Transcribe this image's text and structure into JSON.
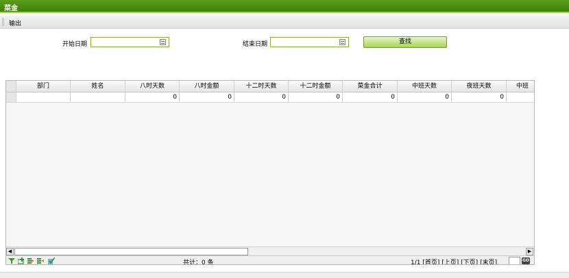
{
  "window": {
    "title": "菜金"
  },
  "toolbar": {
    "export_label": "输出"
  },
  "filters": {
    "start_label": "开始日期",
    "start_value": "",
    "end_label": "结束日期",
    "end_value": "",
    "search_label": "查找"
  },
  "grid": {
    "columns": [
      "部门",
      "姓名",
      "八时天数",
      "八时金额",
      "十二时天数",
      "十二时金额",
      "菜金合计",
      "中班天数",
      "夜班天数",
      "中班"
    ],
    "row": [
      "",
      "",
      "0",
      "0",
      "0",
      "0",
      "0",
      "0",
      "0",
      ""
    ]
  },
  "pager": {
    "total": "共计：0 条",
    "page_info": "1/1",
    "first": "[首页]",
    "prev": "[上页]",
    "next": "[下页]",
    "last": "[末页]",
    "go": "GO"
  },
  "colors": {
    "title_bar": "#4a8c14",
    "accent_border": "#7cae3b",
    "button": "#a8d45a"
  },
  "icons": [
    "filter-icon",
    "add-row-icon",
    "insert-row-icon",
    "delete-row-icon",
    "refresh-icon",
    "calendar-icon"
  ]
}
